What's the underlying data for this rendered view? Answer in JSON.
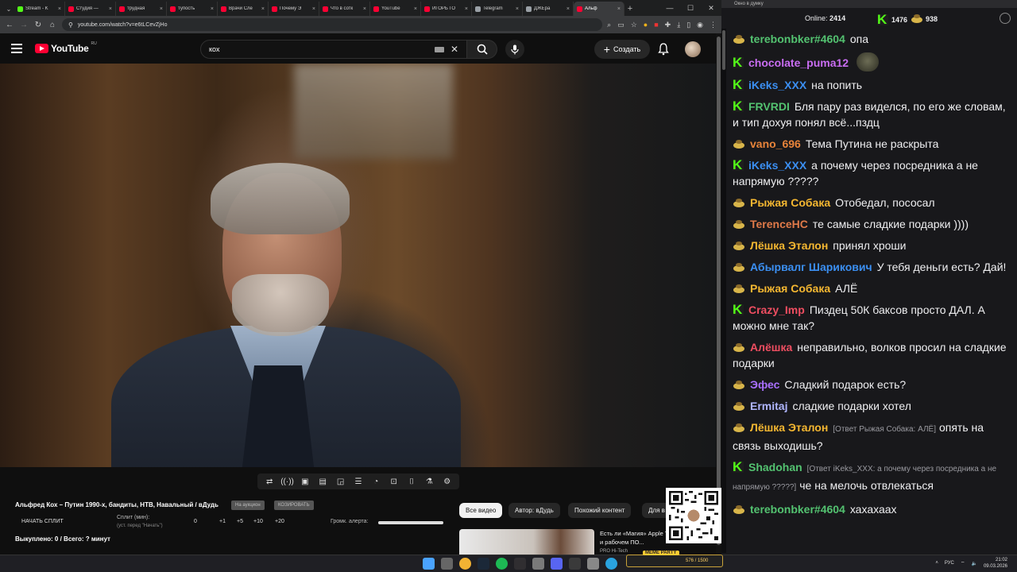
{
  "browser": {
    "tabs": [
      {
        "label": "Stream - K",
        "color": "#53fc18"
      },
      {
        "label": "Студия — ",
        "color": "#ff0033"
      },
      {
        "label": "трудная ",
        "color": "#ff0033"
      },
      {
        "label": "тупость ",
        "color": "#ff0033"
      },
      {
        "label": "Врачи Сле",
        "color": "#ff0033"
      },
      {
        "label": "Почему Э",
        "color": "#ff0033"
      },
      {
        "label": "Что в сотк",
        "color": "#ff0033"
      },
      {
        "label": "YouTube",
        "color": "#ff0033"
      },
      {
        "label": "ИГОРЬ ГО",
        "color": "#ff0033"
      },
      {
        "label": "Telegram",
        "color": "#9aa0a6"
      },
      {
        "label": "ДЖЕра",
        "color": "#9aa0a6"
      },
      {
        "label": "Альф",
        "color": "#ff0033",
        "active": true
      }
    ],
    "url": "youtube.com/watch?v=e6tLCevZjHo"
  },
  "youtube": {
    "logo_text": "YouTube",
    "logo_region": "RU",
    "search_query": "кох",
    "create_label": "Создать",
    "video_title": "Альфред Кох – Путин 1990-х, бандиты, НТВ, Навальный / вДудь",
    "chip1": "На аукцион",
    "chip2": "КОЗИРОВАТЬ",
    "start_split": "НАЧАТЬ СПЛИТ",
    "split_label": "Сплит (мин):",
    "split_hint": "(уст. перед \"Начать\")",
    "split_steps": [
      "0",
      "+1",
      "+5",
      "+10",
      "+20"
    ],
    "alert_label": "Громк. алерта:",
    "alert_volume": 1.0,
    "bought": "Выкуплено: 0 / Всего: ? минут",
    "filters": [
      "Все видео",
      "Автор: вДудь",
      "Похожий контент",
      "Для в"
    ],
    "rec_title": "Есть ли «Магия» Apple Тест в играх и рабочем ПО...",
    "rec_channel": "PRO Hi-Tech"
  },
  "chat": {
    "window_title": "Окно в думку",
    "online_label": "Online:",
    "online": "2414",
    "kick_count": "1476",
    "coin_count": "938",
    "messages": [
      {
        "badge": "coin",
        "user": "terebonbker#4604",
        "color": "#53c270",
        "text": "опа"
      },
      {
        "badge": "kick",
        "user": "chocolate_puma12",
        "color": "#c96df2",
        "text": "",
        "emote": true
      },
      {
        "badge": "kick",
        "user": "iKeks_XXX",
        "color": "#3b8ff2",
        "text": "на попить"
      },
      {
        "badge": "kick",
        "user": "FRVRDI",
        "color": "#53c270",
        "text": "Бля пару раз виделся, по его же словам, и тип дохуя понял всё...пздц"
      },
      {
        "badge": "coin",
        "user": "vano_696",
        "color": "#e8843a",
        "text": "Тема Путина не раскрыта"
      },
      {
        "badge": "kick",
        "user": "iKeks_XXX",
        "color": "#3b8ff2",
        "text": "а почему через посредника а не напрямую ?????"
      },
      {
        "badge": "coin",
        "user": "Рыжая Собака",
        "color": "#f5b731",
        "text": "Отобедал, пососал"
      },
      {
        "badge": "coin",
        "user": "TerenceHC",
        "color": "#e07a49",
        "text": "те самые сладкие подарки ))))"
      },
      {
        "badge": "coin",
        "user": "Лёшка Эталон",
        "color": "#f5b731",
        "text": "принял хроши"
      },
      {
        "badge": "coin",
        "user": "Абырвалг Шарикович",
        "color": "#3b8ff2",
        "text": "У тебя деньги есть? Дай!"
      },
      {
        "badge": "coin",
        "user": "Рыжая Собака",
        "color": "#f5b731",
        "text": "АЛЁ"
      },
      {
        "badge": "kick",
        "user": "Crazy_Imp",
        "color": "#ef4e61",
        "text": "Пиздец 50К баксов просто ДАЛ. А можно мне так?"
      },
      {
        "badge": "coin",
        "user": "Алёшка",
        "color": "#ef4e61",
        "text": "неправильно, волков просил на сладкие подарки"
      },
      {
        "badge": "coin",
        "user": "Эфес",
        "color": "#a970ff",
        "text": "Сладкий подарок есть?"
      },
      {
        "badge": "coin",
        "user": "Ermitaj",
        "color": "#b0b6ff",
        "text": "сладкие подарки хотел"
      },
      {
        "badge": "coin",
        "user": "Лёшка Эталон",
        "color": "#f5b731",
        "reply": "[Ответ Рыжая Собака: АЛЁ]",
        "text": "опять на связь выходишь?"
      },
      {
        "badge": "kick",
        "user": "Shadohan",
        "color": "#53c270",
        "reply": "[Ответ iKeks_XXX: а почему через посредника а не напрямую ?????]",
        "text": "че на мелочь отвлекаться"
      },
      {
        "badge": "coin",
        "user": "terebonbker#4604",
        "color": "#53c270",
        "text": "хахахаах"
      }
    ]
  },
  "overlay": {
    "meme_tag": "MEME PARTY",
    "meme_progress": "576 / 1500"
  },
  "taskbar": {
    "lang": "РУС",
    "time": "21:02",
    "date": "09.03.2026",
    "icons": [
      "windows",
      "search",
      "chrome",
      "steam",
      "spotify",
      "obs",
      "app1",
      "app2",
      "app3",
      "app4",
      "telegram"
    ]
  }
}
